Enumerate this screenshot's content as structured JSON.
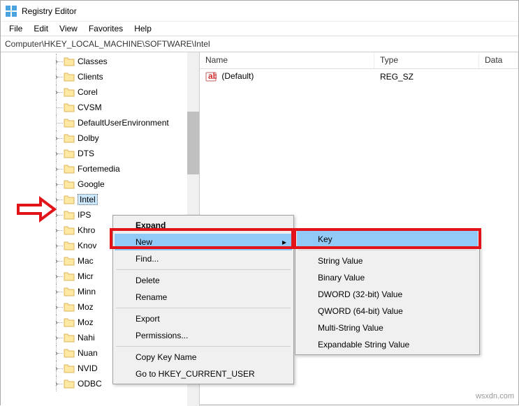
{
  "window": {
    "title": "Registry Editor"
  },
  "menubar": {
    "items": [
      "File",
      "Edit",
      "View",
      "Favorites",
      "Help"
    ]
  },
  "address": {
    "path": "Computer\\HKEY_LOCAL_MACHINE\\SOFTWARE\\Intel"
  },
  "tree": {
    "items": [
      {
        "label": "Classes",
        "expander": ">"
      },
      {
        "label": "Clients",
        "expander": ">"
      },
      {
        "label": "Corel",
        "expander": ">"
      },
      {
        "label": "CVSM",
        "expander": ""
      },
      {
        "label": "DefaultUserEnvironment",
        "expander": ""
      },
      {
        "label": "Dolby",
        "expander": ">"
      },
      {
        "label": "DTS",
        "expander": ">"
      },
      {
        "label": "Fortemedia",
        "expander": ">"
      },
      {
        "label": "Google",
        "expander": ">"
      },
      {
        "label": "Intel",
        "expander": ">",
        "selected": true
      },
      {
        "label": "IPS",
        "expander": ">"
      },
      {
        "label": "Khro",
        "expander": ">"
      },
      {
        "label": "Knov",
        "expander": ">"
      },
      {
        "label": "Mac",
        "expander": ">"
      },
      {
        "label": "Micr",
        "expander": ">"
      },
      {
        "label": "Minn",
        "expander": ">"
      },
      {
        "label": "Moz",
        "expander": ">"
      },
      {
        "label": "Moz",
        "expander": ">"
      },
      {
        "label": "Nahi",
        "expander": ">"
      },
      {
        "label": "Nuan",
        "expander": ">"
      },
      {
        "label": "NVID",
        "expander": ">"
      },
      {
        "label": "ODBC",
        "expander": ">"
      }
    ]
  },
  "list": {
    "columns": {
      "name": "Name",
      "type": "Type",
      "data": "Data"
    },
    "rows": [
      {
        "name": "(Default)",
        "type": "REG_SZ",
        "data": ""
      }
    ]
  },
  "context1": {
    "expand": "Expand",
    "new": "New",
    "find": "Find...",
    "delete": "Delete",
    "rename": "Rename",
    "export": "Export",
    "permissions": "Permissions...",
    "copykey": "Copy Key Name",
    "gotohkcu": "Go to HKEY_CURRENT_USER"
  },
  "context2": {
    "key": "Key",
    "string": "String Value",
    "binary": "Binary Value",
    "dword": "DWORD (32-bit) Value",
    "qword": "QWORD (64-bit) Value",
    "multi": "Multi-String Value",
    "expand": "Expandable String Value"
  },
  "watermark": "wsxdn.com"
}
